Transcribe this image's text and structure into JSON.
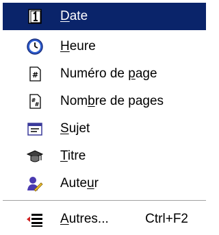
{
  "menu": {
    "items": [
      {
        "pre": "",
        "key": "D",
        "post": "ate",
        "icon": "date-calendar-icon"
      },
      {
        "pre": "",
        "key": "H",
        "post": "eure",
        "icon": "clock-icon"
      },
      {
        "pre": "Numéro de ",
        "key": "p",
        "post": "age",
        "icon": "page-number-icon"
      },
      {
        "pre": "Nom",
        "key": "b",
        "post": "re de pages",
        "icon": "page-count-icon"
      },
      {
        "pre": "",
        "key": "S",
        "post": "ujet",
        "icon": "subject-icon"
      },
      {
        "pre": "",
        "key": "T",
        "post": "itre",
        "icon": "title-icon"
      },
      {
        "pre": "Aute",
        "key": "u",
        "post": "r",
        "icon": "author-icon"
      }
    ],
    "more": {
      "pre": "",
      "key": "A",
      "post": "utres...",
      "icon": "more-fields-icon",
      "shortcut": "Ctrl+F2"
    }
  },
  "colors": {
    "highlight": "#0a246a",
    "highlight_text": "#ffffff",
    "text": "#000000"
  }
}
